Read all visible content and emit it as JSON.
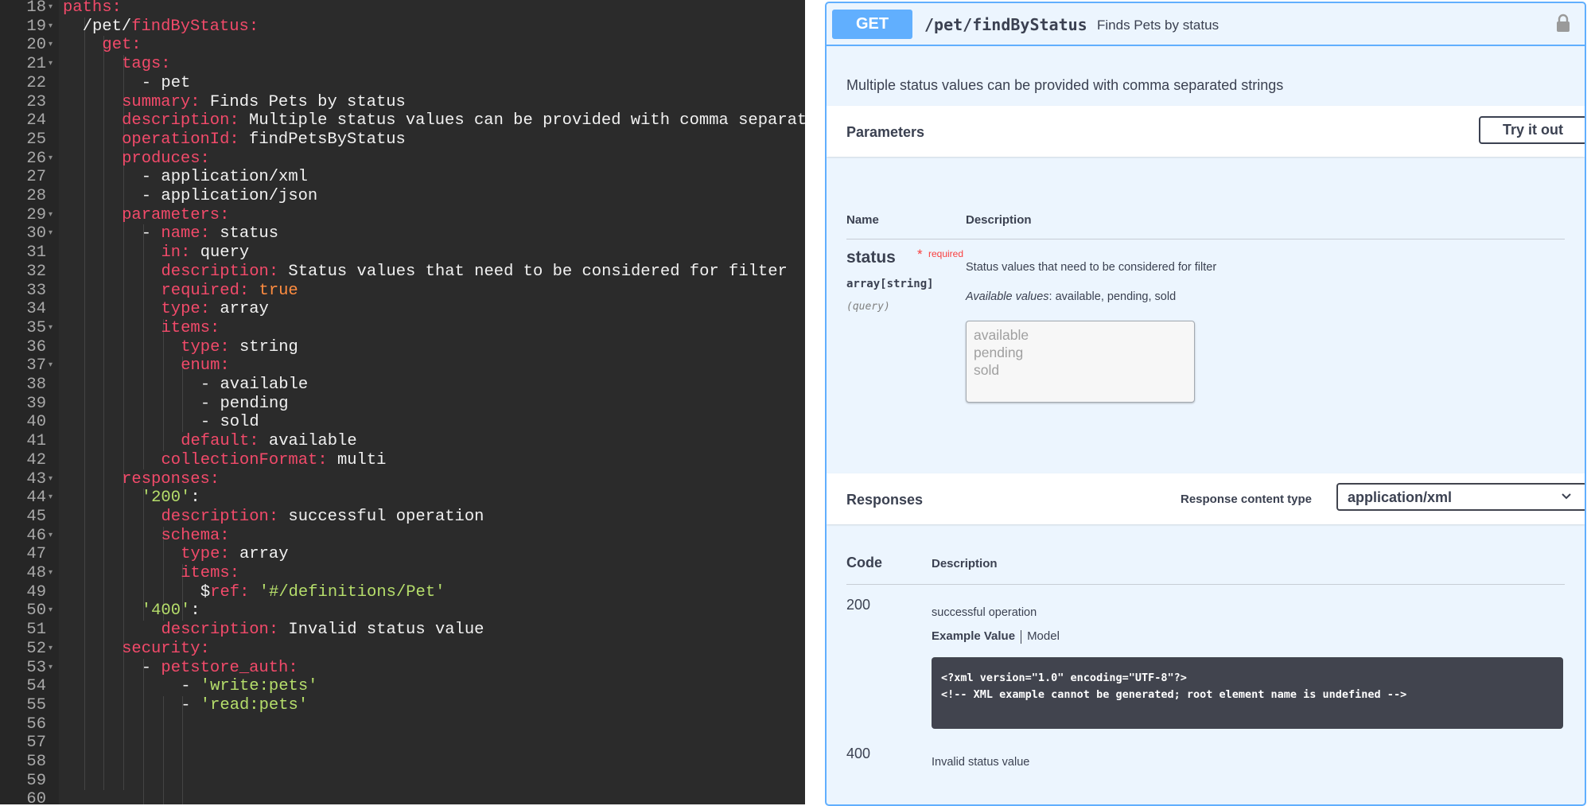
{
  "editor": {
    "lines": [
      {
        "n": "18",
        "fold": true,
        "indent": 0,
        "tokens": [
          {
            "t": "paths:",
            "c": "k"
          }
        ]
      },
      {
        "n": "19",
        "fold": true,
        "indent": 2,
        "tokens": [
          {
            "t": "/pet/",
            "c": "p"
          },
          {
            "t": "findByStatus:",
            "c": "k"
          }
        ]
      },
      {
        "n": "20",
        "fold": true,
        "indent": 4,
        "tokens": [
          {
            "t": "get:",
            "c": "k"
          }
        ]
      },
      {
        "n": "21",
        "fold": true,
        "indent": 6,
        "tokens": [
          {
            "t": "tags:",
            "c": "k"
          }
        ]
      },
      {
        "n": "22",
        "fold": false,
        "indent": 8,
        "tokens": [
          {
            "t": "- pet",
            "c": "p"
          }
        ]
      },
      {
        "n": "23",
        "fold": false,
        "indent": 6,
        "tokens": [
          {
            "t": "summary:",
            "c": "k"
          },
          {
            "t": " Finds Pets by status",
            "c": "p"
          }
        ]
      },
      {
        "n": "24",
        "fold": false,
        "indent": 6,
        "tokens": [
          {
            "t": "description:",
            "c": "k"
          },
          {
            "t": " Multiple status values can be provided with comma separated strings",
            "c": "p"
          }
        ]
      },
      {
        "n": "25",
        "fold": false,
        "indent": 6,
        "tokens": [
          {
            "t": "operationId:",
            "c": "k"
          },
          {
            "t": " findPetsByStatus",
            "c": "p"
          }
        ]
      },
      {
        "n": "26",
        "fold": true,
        "indent": 6,
        "tokens": [
          {
            "t": "produces:",
            "c": "k"
          }
        ]
      },
      {
        "n": "27",
        "fold": false,
        "indent": 8,
        "tokens": [
          {
            "t": "- application/xml",
            "c": "p"
          }
        ]
      },
      {
        "n": "28",
        "fold": false,
        "indent": 8,
        "tokens": [
          {
            "t": "- application/json",
            "c": "p"
          }
        ]
      },
      {
        "n": "29",
        "fold": true,
        "indent": 6,
        "tokens": [
          {
            "t": "parameters:",
            "c": "k"
          }
        ]
      },
      {
        "n": "30",
        "fold": true,
        "indent": 8,
        "tokens": [
          {
            "t": "- ",
            "c": "p"
          },
          {
            "t": "name:",
            "c": "k"
          },
          {
            "t": " status",
            "c": "p"
          }
        ]
      },
      {
        "n": "31",
        "fold": false,
        "indent": 10,
        "tokens": [
          {
            "t": "in:",
            "c": "k"
          },
          {
            "t": " query",
            "c": "p"
          }
        ]
      },
      {
        "n": "32",
        "fold": false,
        "indent": 10,
        "tokens": [
          {
            "t": "description:",
            "c": "k"
          },
          {
            "t": " Status values that need to be considered for filter",
            "c": "p"
          }
        ]
      },
      {
        "n": "33",
        "fold": false,
        "indent": 10,
        "tokens": [
          {
            "t": "required:",
            "c": "k"
          },
          {
            "t": " true",
            "c": "b"
          }
        ]
      },
      {
        "n": "34",
        "fold": false,
        "indent": 10,
        "tokens": [
          {
            "t": "type:",
            "c": "k"
          },
          {
            "t": " array",
            "c": "p"
          }
        ]
      },
      {
        "n": "35",
        "fold": true,
        "indent": 10,
        "tokens": [
          {
            "t": "items:",
            "c": "k"
          }
        ]
      },
      {
        "n": "36",
        "fold": false,
        "indent": 12,
        "tokens": [
          {
            "t": "type:",
            "c": "k"
          },
          {
            "t": " string",
            "c": "p"
          }
        ]
      },
      {
        "n": "37",
        "fold": true,
        "indent": 12,
        "tokens": [
          {
            "t": "enum:",
            "c": "k"
          }
        ]
      },
      {
        "n": "38",
        "fold": false,
        "indent": 14,
        "tokens": [
          {
            "t": "- available",
            "c": "p"
          }
        ]
      },
      {
        "n": "39",
        "fold": false,
        "indent": 14,
        "tokens": [
          {
            "t": "- pending",
            "c": "p"
          }
        ]
      },
      {
        "n": "40",
        "fold": false,
        "indent": 14,
        "tokens": [
          {
            "t": "- sold",
            "c": "p"
          }
        ]
      },
      {
        "n": "41",
        "fold": false,
        "indent": 12,
        "tokens": [
          {
            "t": "default:",
            "c": "k"
          },
          {
            "t": " available",
            "c": "p"
          }
        ]
      },
      {
        "n": "42",
        "fold": false,
        "indent": 10,
        "tokens": [
          {
            "t": "collectionFormat:",
            "c": "k"
          },
          {
            "t": " multi",
            "c": "p"
          }
        ]
      },
      {
        "n": "43",
        "fold": true,
        "indent": 6,
        "tokens": [
          {
            "t": "responses:",
            "c": "k"
          }
        ]
      },
      {
        "n": "44",
        "fold": true,
        "indent": 8,
        "tokens": [
          {
            "t": "'200'",
            "c": "s"
          },
          {
            "t": ":",
            "c": "p"
          }
        ]
      },
      {
        "n": "45",
        "fold": false,
        "indent": 10,
        "tokens": [
          {
            "t": "description:",
            "c": "k"
          },
          {
            "t": " successful operation",
            "c": "p"
          }
        ]
      },
      {
        "n": "46",
        "fold": true,
        "indent": 10,
        "tokens": [
          {
            "t": "schema:",
            "c": "k"
          }
        ]
      },
      {
        "n": "47",
        "fold": false,
        "indent": 12,
        "tokens": [
          {
            "t": "type:",
            "c": "k"
          },
          {
            "t": " array",
            "c": "p"
          }
        ]
      },
      {
        "n": "48",
        "fold": true,
        "indent": 12,
        "tokens": [
          {
            "t": "items:",
            "c": "k"
          }
        ]
      },
      {
        "n": "49",
        "fold": false,
        "indent": 14,
        "tokens": [
          {
            "t": "$",
            "c": "p"
          },
          {
            "t": "ref:",
            "c": "k"
          },
          {
            "t": " '#/definitions/Pet'",
            "c": "s"
          }
        ]
      },
      {
        "n": "50",
        "fold": true,
        "indent": 8,
        "tokens": [
          {
            "t": "'400'",
            "c": "s"
          },
          {
            "t": ":",
            "c": "p"
          }
        ]
      },
      {
        "n": "51",
        "fold": false,
        "indent": 10,
        "tokens": [
          {
            "t": "description:",
            "c": "k"
          },
          {
            "t": " Invalid status value",
            "c": "p"
          }
        ]
      },
      {
        "n": "52",
        "fold": true,
        "indent": 6,
        "tokens": [
          {
            "t": "security:",
            "c": "k"
          }
        ]
      },
      {
        "n": "53",
        "fold": true,
        "indent": 8,
        "tokens": [
          {
            "t": "- ",
            "c": "p"
          },
          {
            "t": "petstore_auth:",
            "c": "k"
          }
        ]
      },
      {
        "n": "54",
        "fold": false,
        "indent": 12,
        "tokens": [
          {
            "t": "- ",
            "c": "p"
          },
          {
            "t": "'write:pets'",
            "c": "s"
          }
        ]
      },
      {
        "n": "55",
        "fold": false,
        "indent": 12,
        "tokens": [
          {
            "t": "- ",
            "c": "p"
          },
          {
            "t": "'read:pets'",
            "c": "s"
          }
        ]
      },
      {
        "n": "56",
        "fold": false,
        "indent": 0,
        "tokens": []
      },
      {
        "n": "57",
        "fold": false,
        "indent": 0,
        "tokens": []
      },
      {
        "n": "58",
        "fold": false,
        "indent": 0,
        "tokens": []
      },
      {
        "n": "59",
        "fold": false,
        "indent": 0,
        "tokens": []
      },
      {
        "n": "60",
        "fold": false,
        "indent": 0,
        "tokens": []
      }
    ],
    "colors": {
      "background": "#2b2b2b",
      "key": "#f24a6a",
      "string": "#b6de6b",
      "boolean": "#ff8c40",
      "plain": "#f1f1f1"
    }
  },
  "operation": {
    "method": "GET",
    "path": "/pet/findByStatus",
    "summary": "Finds Pets by status",
    "description": "Multiple status values can be provided with comma separated strings",
    "lock_icon": "lock-icon",
    "colors": {
      "accent": "#61affe",
      "background": "#ecf5fe"
    }
  },
  "parameters": {
    "title": "Parameters",
    "try_button": "Try it out",
    "col_name": "Name",
    "col_description": "Description",
    "param": {
      "name": "status",
      "required_star": "*",
      "required_label": "required",
      "type": "array[string]",
      "in": "(query)",
      "description": "Status values that need to be considered for filter",
      "available_label": "Available values",
      "available_values": ": available, pending, sold",
      "options": [
        "available",
        "pending",
        "sold"
      ]
    }
  },
  "responses": {
    "title": "Responses",
    "content_type_label": "Response content type",
    "content_type_value": "application/xml",
    "col_code": "Code",
    "col_description": "Description",
    "items": [
      {
        "code": "200",
        "description": "successful operation"
      },
      {
        "code": "400",
        "description": "Invalid status value"
      }
    ],
    "example_tab": "Example Value",
    "model_tab": "Model",
    "example_code": [
      "<?xml version=\"1.0\" encoding=\"UTF-8\"?>",
      "<!-- XML example cannot be generated; root element name is undefined -->"
    ]
  }
}
